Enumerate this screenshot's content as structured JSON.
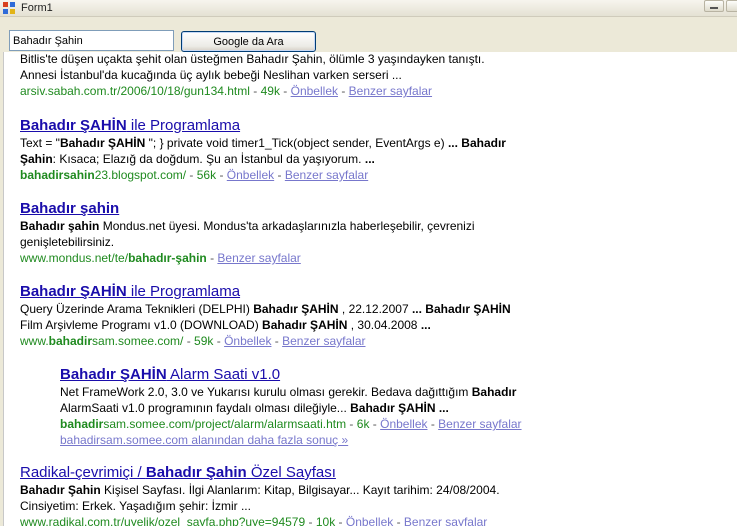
{
  "window": {
    "title": "Form1"
  },
  "search": {
    "value": "Bahadır Şahin",
    "button_label": "Google da Ara"
  },
  "results": [
    {
      "snippet_line1": "Bitlis'te düşen uçakta şehit olan üsteğmen Bahadır Şahin, ölümle 3 yaşındayken tanıştı.",
      "snippet_line2": "Annesi İstanbul'da kucağında üç aylık bebeği Neslihan varken serseri ...",
      "url": "arsiv.sabah.com.tr/2006/10/18/gun134.html",
      "size": "49k",
      "cache_label": "Önbellek",
      "similar_label": "Benzer sayfalar"
    },
    {
      "title_bold": "Bahadır ŞAHİN",
      "title_rest": " ile Programlama",
      "snippet_line1_a": "Text = \"",
      "snippet_line1_b": "Bahadır ŞAHİN",
      "snippet_line1_c": " \"; } private void timer1_Tick(object sender, EventArgs e) ",
      "snippet_line1_d": "... Bahadır",
      "snippet_line2_a": "Şahin",
      "snippet_line2_b": ": Kısaca; Elazığ da doğdum. Şu an İstanbul da yaşıyorum. ",
      "snippet_line2_c": "...",
      "url_bold": "bahadirsahin",
      "url_rest": "23.blogspot.com/",
      "size": "56k",
      "cache_label": "Önbellek",
      "similar_label": "Benzer sayfalar"
    },
    {
      "title_bold": "Bahadır şahin",
      "snippet_line1_a": "Bahadır şahin",
      "snippet_line1_b": " Mondus.net üyesi. Mondus'ta arkadaşlarınızla haberleşebilir, çevrenizi",
      "snippet_line2": "genişletebilirsiniz.",
      "url_rest": "www.mondus.net/te/",
      "url_bold": "bahadır-şahin",
      "similar_label": "Benzer sayfalar"
    },
    {
      "title_bold": "Bahadır ŞAHİN",
      "title_rest": " ile Programlama",
      "snippet_line1_a": "Query Üzerinde Arama Teknikleri (DELPHI) ",
      "snippet_line1_b": "Bahadır ŞAHİN",
      "snippet_line1_c": " , 22.12.2007 ",
      "snippet_line1_d": "... Bahadır ŞAHİN",
      "snippet_line2_a": "Film Arşivleme Programı v1.0 (DOWNLOAD) ",
      "snippet_line2_b": "Bahadır ŞAHİN",
      "snippet_line2_c": " , 30.04.2008 ",
      "snippet_line2_d": "...",
      "url_a": "www.",
      "url_bold": "bahadir",
      "url_rest": "sam.somee.com/",
      "size": "59k",
      "cache_label": "Önbellek",
      "similar_label": "Benzer sayfalar"
    },
    {
      "title_bold": "Bahadır ŞAHİN",
      "title_rest": " Alarm Saati v1.0",
      "snippet_line1_a": "Net FrameWork 2.0, 3.0 ve Yukarısı kurulu olması gerekir. Bedava dağıttığım ",
      "snippet_line1_b": "Bahadır",
      "snippet_line2_a": "AlarmSaati v1.0 programının faydalı olması dileğiyle... ",
      "snippet_line2_b": "Bahadır ŞAHİN",
      "snippet_line2_c": " ...",
      "url_bold": "bahadir",
      "url_rest": "sam.somee.com/project/alarm/alarmsaati.htm",
      "size": "6k",
      "cache_label": "Önbellek",
      "similar_label": "Benzer sayfalar",
      "more_label": "bahadirsam.somee.com alanından daha fazla sonuç »"
    },
    {
      "title_a": "Radikal-çevrimiçi / ",
      "title_bold": "Bahadır Şahin",
      "title_rest": " Özel Sayfası",
      "snippet_line1_a": "Bahadır Şahin",
      "snippet_line1_b": " Kişisel Sayfası. İlgi Alanlarım: Kitap, Bilgisayar... Kayıt tarihim: 24/08/2004.",
      "snippet_line2": "Cinsiyetim: Erkek. Yaşadığım şehir: İzmir ...",
      "url": "www.radikal.com.tr/uyelik/ozel_sayfa.php?uye=94579",
      "size": "10k",
      "cache_label": "Önbellek",
      "similar_label": "Benzer sayfalar"
    }
  ]
}
